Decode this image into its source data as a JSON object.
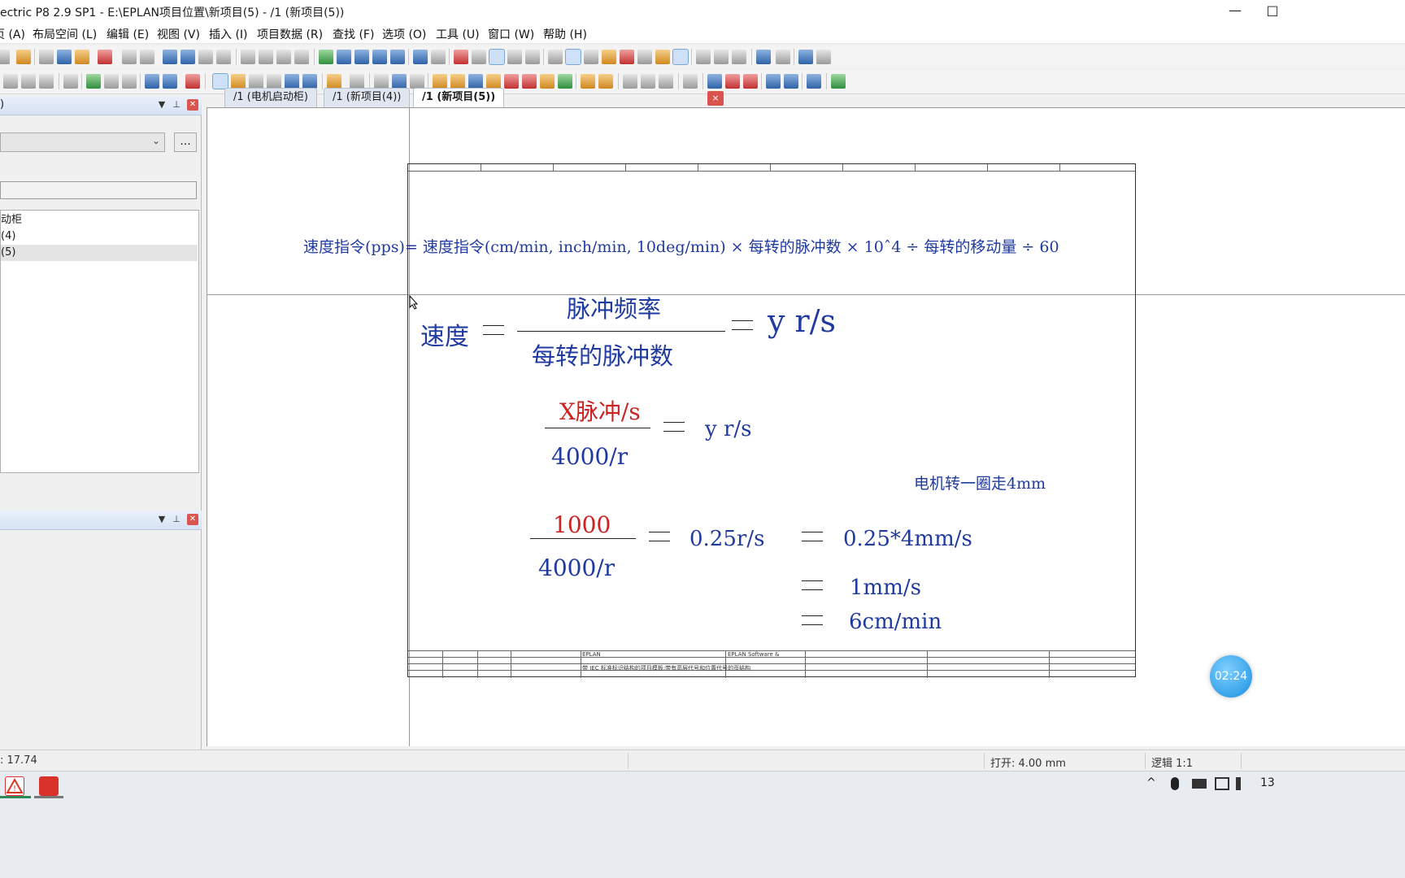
{
  "window": {
    "title": "ectric P8 2.9 SP1 - E:\\EPLAN项目位置\\新项目(5) - /1 (新项目(5))",
    "minimize_icon": "minimize-icon",
    "maximize_icon": "maximize-icon"
  },
  "menu": [
    "页 (A)",
    "布局空间 (L)",
    "编辑 (E)",
    "视图 (V)",
    "插入 (I)",
    "项目数据 (R)",
    "查找 (F)",
    "选项 (O)",
    "工具 (U)",
    "窗口 (W)",
    "帮助 (H)"
  ],
  "left_panel": {
    "top_title": ")",
    "combo_value": "",
    "dots_label": "...",
    "filter_value": "",
    "tree_items": [
      "动柜",
      "(4)",
      "(5)"
    ],
    "bottom_title": ""
  },
  "tabs": [
    "/1 (电机启动柜)",
    "/1 (新项目(4))",
    "/1 (新项目(5))"
  ],
  "tab_close_label": "×",
  "drawing": {
    "formula_line": "速度指令(pps)= 速度指令(cm/min, inch/min, 10deg/min) × 每转的脉冲数 × 10ˆ4 ÷ 每转的移动量 ÷ 60",
    "speed_label": "速度",
    "pulse_freq": "脉冲频率",
    "pulses_per_rev": "每转的脉冲数",
    "result1": "y r/s",
    "x_pulse": "X脉冲/s",
    "denominator1": "4000/r",
    "result2": "y r/s",
    "motor_note": "电机转一圈走4mm",
    "num1000": "1000",
    "denominator2": "4000/r",
    "r1": "0.25r/s",
    "r2": "0.25*4mm/s",
    "r3": "1mm/s",
    "r4": "6cm/min",
    "title_block": {
      "company": "EPLAN",
      "software": "EPLAN Software &",
      "desc": "带 IEC 标准标识结构的项目模板:带有高层代号和位置代号的页结构"
    }
  },
  "timer": "02:24",
  "status": {
    "coord": ": 17.74",
    "grid": "打开: 4.00 mm",
    "logic": "逻辑 1:1"
  },
  "taskbar": {
    "clock": "13"
  }
}
